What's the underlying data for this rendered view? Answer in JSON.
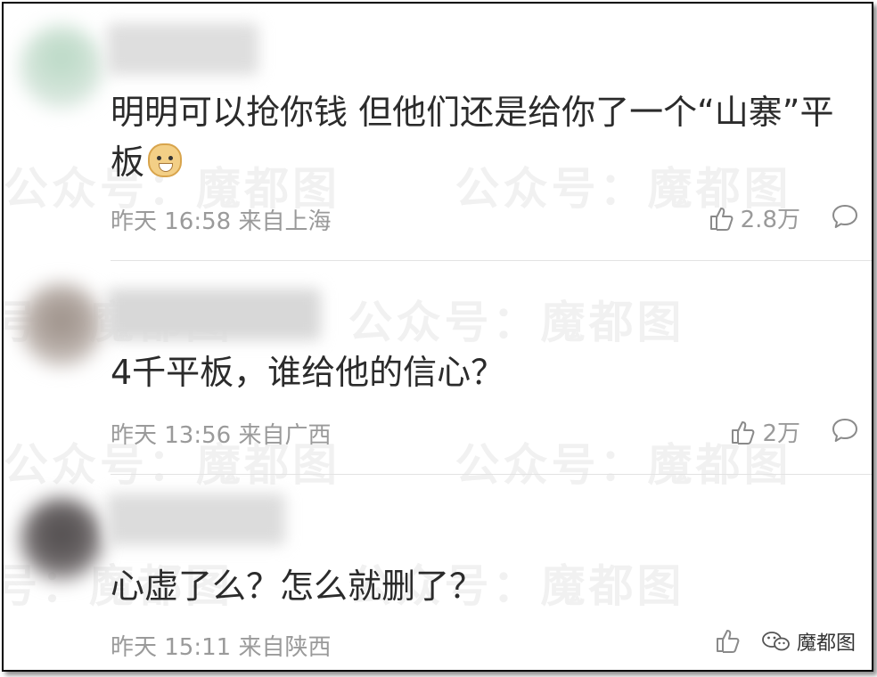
{
  "watermark": "公众号：魔都图",
  "comments": [
    {
      "text": "明明可以抢你钱 但他们还是给你了一个“山寨”平板",
      "emoji": "doge-emoji",
      "meta": "昨天 16:58 来自上海",
      "likes": "2.8万"
    },
    {
      "text": "4千平板，谁给他的信心？",
      "meta": "昨天 13:56 来自广西",
      "likes": "2万"
    },
    {
      "text": "心虚了么？怎么就删了？",
      "meta": "昨天 15:11 来自陕西",
      "likes": ""
    }
  ],
  "badge": {
    "label": "魔都图",
    "icon": "wechat-icon"
  },
  "icons": {
    "like": "thumbs-up-icon",
    "reply": "comment-bubble-icon"
  },
  "colors": {
    "text": "#2b2b2b",
    "meta": "#9a9a9a"
  }
}
